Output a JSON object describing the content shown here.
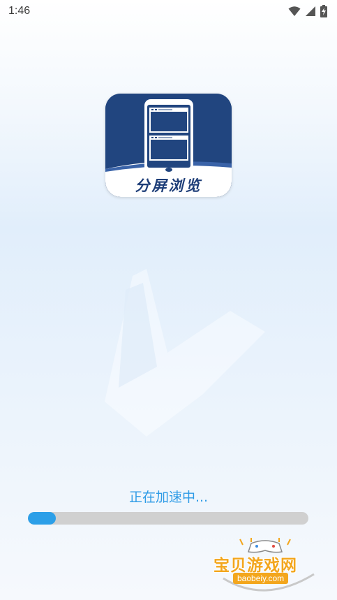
{
  "status_bar": {
    "time": "1:46",
    "icons": [
      "wifi-icon",
      "signal-icon",
      "battery-charging-icon"
    ]
  },
  "app_icon": {
    "title": "分屏浏览",
    "colors": {
      "background": "#21457f",
      "accent": "#ffffff"
    }
  },
  "loading": {
    "text": "正在加速中...",
    "progress": 0.1,
    "colors": {
      "text": "#2e9be6",
      "fill": "#2c9fe8",
      "track": "#d0d0d0"
    }
  },
  "watermark": {
    "title": "宝贝游戏网",
    "url": "baobeiy.com",
    "color": "#f3a61d"
  }
}
